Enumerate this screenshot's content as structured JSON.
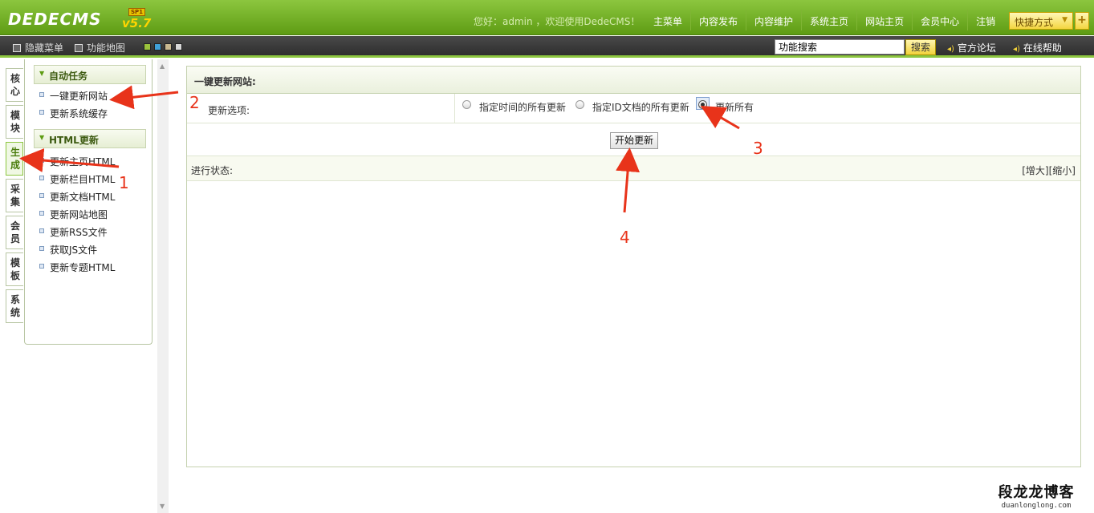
{
  "header": {
    "logo": "DEDECMS",
    "version": "v5.7",
    "edition": "SP1",
    "welcome": "您好：admin ，欢迎使用DedeCMS！",
    "nav": [
      "主菜单",
      "内容发布",
      "内容维护",
      "系统主页",
      "网站主页",
      "会员中心",
      "注销"
    ],
    "quick_label": "快捷方式",
    "plus": "+"
  },
  "toolbar": {
    "hide_menu": "隐藏菜单",
    "func_map": "功能地图",
    "search_value": "功能搜索",
    "search_button": "搜索",
    "forum": "官方论坛",
    "help": "在线帮助",
    "swatches": [
      "#9ac23c",
      "#3fa0d8",
      "#c8b890",
      "#d8d8d8"
    ]
  },
  "vtabs": [
    {
      "label": "核心",
      "active": false
    },
    {
      "label": "模块",
      "active": false
    },
    {
      "label": "生成",
      "active": true
    },
    {
      "label": "采集",
      "active": false
    },
    {
      "label": "会员",
      "active": false
    },
    {
      "label": "模板",
      "active": false
    },
    {
      "label": "系统",
      "active": false
    }
  ],
  "menu": {
    "group1": {
      "title": "自动任务",
      "items": [
        "一键更新网站",
        "更新系统缓存"
      ]
    },
    "group2": {
      "title": "HTML更新",
      "items": [
        "更新主页HTML",
        "更新栏目HTML",
        "更新文档HTML",
        "更新网站地图",
        "更新RSS文件",
        "获取JS文件",
        "更新专题HTML"
      ]
    }
  },
  "main": {
    "title": "一键更新网站:",
    "option_label": "更新选项:",
    "options": [
      {
        "label": "指定时间的所有更新",
        "checked": false
      },
      {
        "label": "指定ID文档的所有更新",
        "checked": false
      },
      {
        "label": "更新所有",
        "checked": true
      }
    ],
    "start_button": "开始更新",
    "status_label": "进行状态:",
    "zoom_in": "[增大]",
    "zoom_out": "[缩小]"
  },
  "annotations": {
    "colors": {
      "arrow": "#e8331a"
    },
    "numbers": [
      "1",
      "2",
      "3",
      "4"
    ]
  },
  "watermark": {
    "name": "段龙龙博客",
    "url": "duanlonglong.com"
  }
}
